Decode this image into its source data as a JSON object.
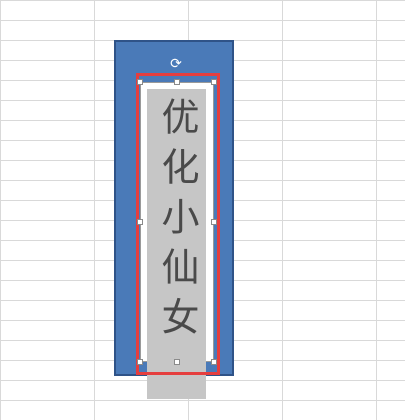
{
  "textbox": {
    "text": "优化小仙女"
  },
  "icons": {
    "rotate": "rotate-handle-icon"
  },
  "colors": {
    "shape_fill": "#4a7ab8",
    "selection_frame": "#e53e3e",
    "text_fill": "#c6c6c6"
  }
}
